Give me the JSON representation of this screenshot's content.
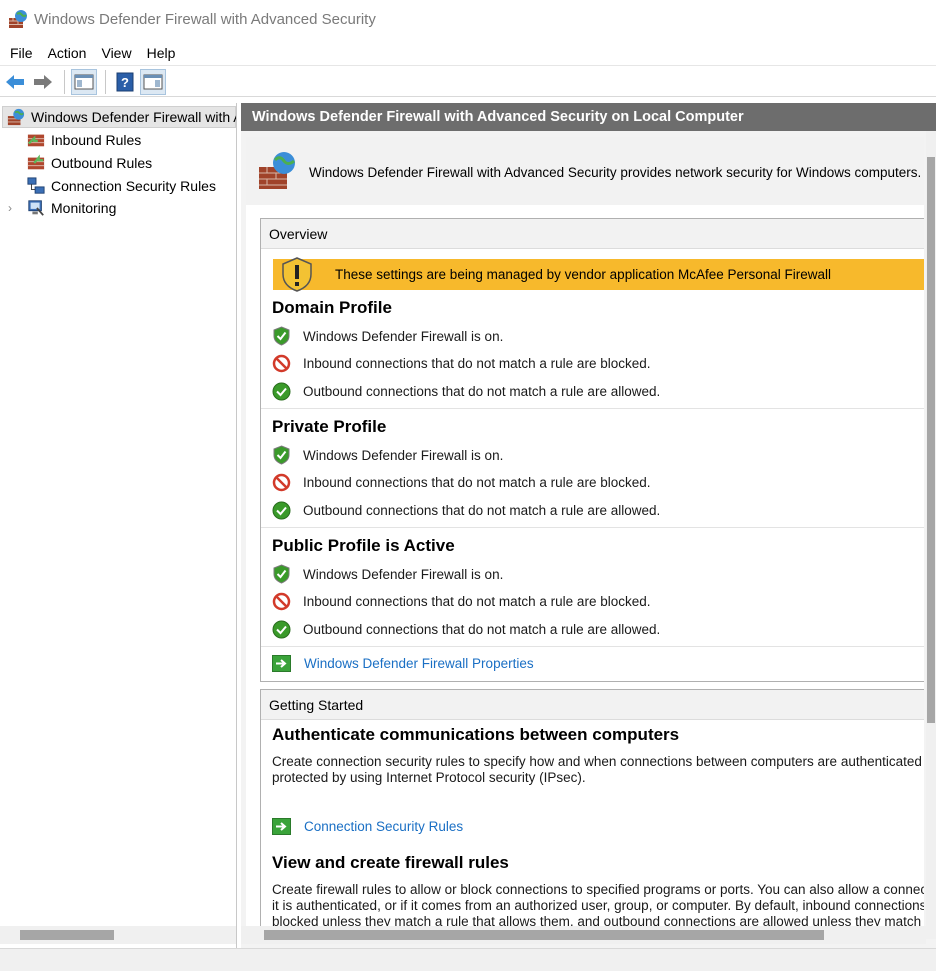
{
  "window": {
    "title": "Windows Defender Firewall with Advanced Security"
  },
  "menu": [
    "File",
    "Action",
    "View",
    "Help"
  ],
  "toolbar": {
    "back": "back-arrow",
    "forward": "forward-arrow",
    "show_hide_tree": "console-tree-icon",
    "help": "help-icon",
    "show_hide_action": "action-pane-icon"
  },
  "tree": {
    "root": "Windows Defender Firewall with Advanced Security on Local Computer",
    "items": [
      {
        "label": "Inbound Rules"
      },
      {
        "label": "Outbound Rules"
      },
      {
        "label": "Connection Security Rules"
      },
      {
        "label": "Monitoring"
      }
    ]
  },
  "main": {
    "header": "Windows Defender Firewall with Advanced Security on Local Computer",
    "intro": "Windows Defender Firewall with Advanced Security provides network security for Windows computers.",
    "overview": {
      "title": "Overview",
      "warning": "These settings are being managed by vendor application McAfee  Personal Firewall",
      "profiles": [
        {
          "title": "Domain Profile",
          "lines": [
            "Windows Defender Firewall is on.",
            "Inbound connections that do not match a rule are blocked.",
            "Outbound connections that do not match a rule are allowed."
          ]
        },
        {
          "title": "Private Profile",
          "lines": [
            "Windows Defender Firewall is on.",
            "Inbound connections that do not match a rule are blocked.",
            "Outbound connections that do not match a rule are allowed."
          ]
        },
        {
          "title": "Public Profile is Active",
          "lines": [
            "Windows Defender Firewall is on.",
            "Inbound connections that do not match a rule are blocked.",
            "Outbound connections that do not match a rule are allowed."
          ]
        }
      ],
      "properties_link": "Windows Defender Firewall Properties"
    },
    "getting_started": {
      "title": "Getting Started",
      "auth_heading": "Authenticate communications between computers",
      "auth_desc_1": "Create connection security rules to specify how and when connections between computers are authenticated and",
      "auth_desc_2": "protected by using Internet Protocol security (IPsec).",
      "auth_link": "Connection Security Rules",
      "rules_heading": "View and create firewall rules",
      "rules_desc_1": "Create firewall rules to allow or block connections to specified programs or ports. You can also allow a connection if",
      "rules_desc_2": "it is authenticated, or if it comes from an authorized user, group, or computer. By default, inbound connections are",
      "rules_desc_3": "blocked unless they match a rule that allows them, and outbound connections are allowed unless they match a rule"
    }
  },
  "colors": {
    "header_bg": "#6d6d6d",
    "warning_bg": "#f7b92c",
    "link": "#1a6fc4",
    "ok_green": "#3a9a2a",
    "block_red": "#d23a2a"
  }
}
